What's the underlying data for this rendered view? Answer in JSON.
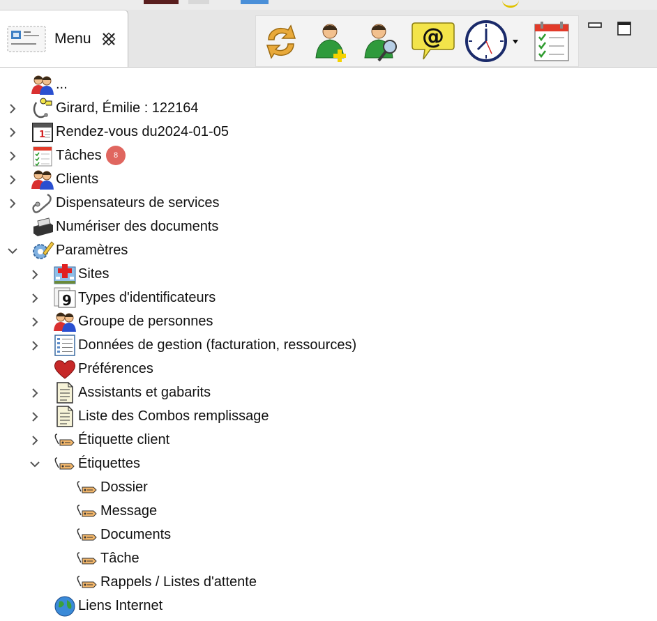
{
  "tab": {
    "label": "Menu"
  },
  "tree": [
    {
      "key": "r0",
      "label": "...",
      "level": 0,
      "twisty": "none",
      "icon": "people-icon"
    },
    {
      "key": "r1",
      "label": "Girard, Émilie : 122164",
      "level": 0,
      "twisty": "collapsed",
      "icon": "stethoscope-key-icon"
    },
    {
      "key": "r2",
      "label": "Rendez-vous du2024-01-05",
      "level": 0,
      "twisty": "collapsed",
      "icon": "calendar-day-icon"
    },
    {
      "key": "r3",
      "label": "Tâches",
      "level": 0,
      "twisty": "collapsed",
      "icon": "task-list-icon",
      "badge": "8"
    },
    {
      "key": "r4",
      "label": "Clients",
      "level": 0,
      "twisty": "collapsed",
      "icon": "people-icon"
    },
    {
      "key": "r5",
      "label": "Dispensateurs de services",
      "level": 0,
      "twisty": "collapsed",
      "icon": "stethoscope-icon"
    },
    {
      "key": "r6",
      "label": "Numériser des documents",
      "level": 0,
      "twisty": "none",
      "icon": "scanner-icon"
    },
    {
      "key": "r7",
      "label": "Paramètres",
      "level": 0,
      "twisty": "expanded",
      "icon": "settings-pencil-icon"
    },
    {
      "key": "r8",
      "label": "Sites",
      "level": 1,
      "twisty": "collapsed",
      "icon": "hospital-icon"
    },
    {
      "key": "r9",
      "label": "Types d'identificateurs",
      "level": 1,
      "twisty": "collapsed",
      "icon": "id-number-icon"
    },
    {
      "key": "r10",
      "label": "Groupe de personnes",
      "level": 1,
      "twisty": "collapsed",
      "icon": "people-icon"
    },
    {
      "key": "r11",
      "label": "Données de gestion (facturation, ressources)",
      "level": 1,
      "twisty": "collapsed",
      "icon": "list-document-icon"
    },
    {
      "key": "r12",
      "label": "Préférences",
      "level": 1,
      "twisty": "none",
      "icon": "heart-icon"
    },
    {
      "key": "r13",
      "label": "Assistants et gabarits",
      "level": 1,
      "twisty": "collapsed",
      "icon": "document-icon"
    },
    {
      "key": "r14",
      "label": "Liste des Combos remplissage",
      "level": 1,
      "twisty": "collapsed",
      "icon": "document-icon"
    },
    {
      "key": "r15",
      "label": "Étiquette client",
      "level": 1,
      "twisty": "collapsed",
      "icon": "tag-icon"
    },
    {
      "key": "r16",
      "label": "Étiquettes",
      "level": 1,
      "twisty": "expanded",
      "icon": "tag-icon"
    },
    {
      "key": "r17",
      "label": "Dossier",
      "level": 2,
      "twisty": "none",
      "icon": "tag-icon"
    },
    {
      "key": "r18",
      "label": "Message",
      "level": 2,
      "twisty": "none",
      "icon": "tag-icon"
    },
    {
      "key": "r19",
      "label": "Documents",
      "level": 2,
      "twisty": "none",
      "icon": "tag-icon"
    },
    {
      "key": "r20",
      "label": "Tâche",
      "level": 2,
      "twisty": "none",
      "icon": "tag-icon"
    },
    {
      "key": "r21",
      "label": "Rappels / Listes d'attente",
      "level": 2,
      "twisty": "none",
      "icon": "tag-icon"
    },
    {
      "key": "r22",
      "label": "Liens Internet",
      "level": 1,
      "twisty": "none",
      "icon": "globe-icon"
    }
  ],
  "colors": {
    "badge": "#e0665f",
    "toolbar_bg": "#f3f3f3",
    "tab_bar_bg": "#e6e6e6"
  }
}
